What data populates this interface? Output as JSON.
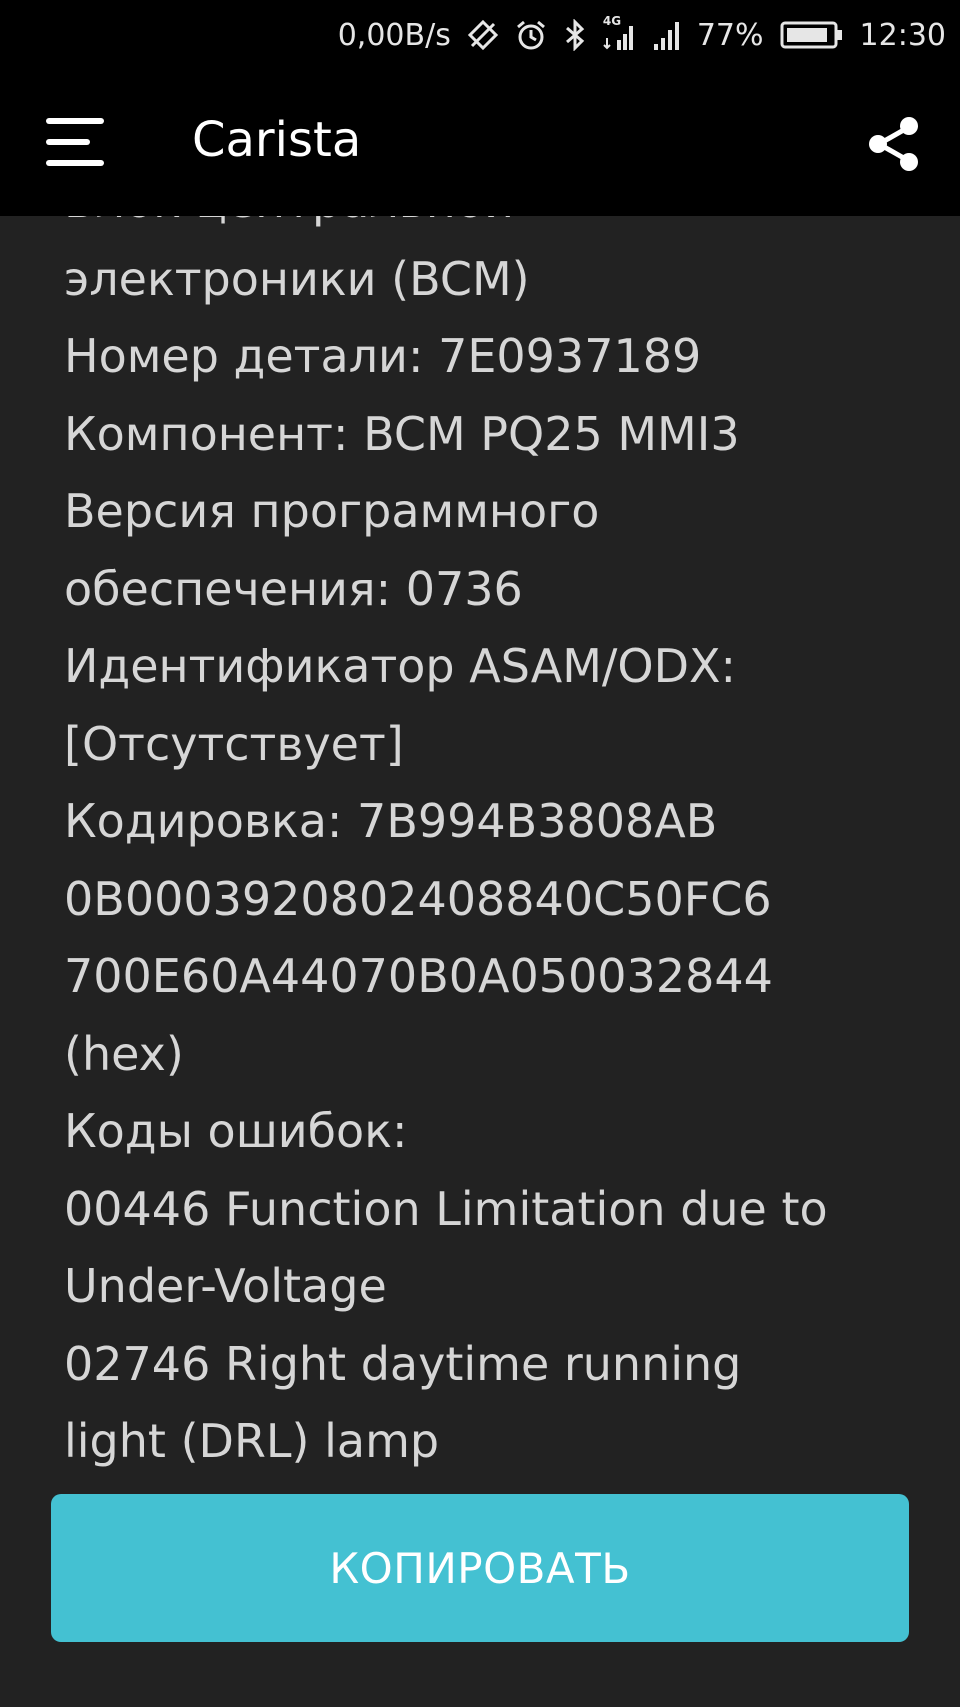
{
  "status_bar": {
    "net_speed": "0,00B/s",
    "network_type": "4G",
    "battery": "77%",
    "time": "12:30",
    "icons": [
      "data-saver-icon",
      "alarm-icon",
      "bluetooth-icon",
      "mobile-data-icon",
      "signal-icon",
      "battery-icon"
    ]
  },
  "app_bar": {
    "title": "Carista",
    "menu_icon": "hamburger-menu-icon",
    "share_icon": "share-icon"
  },
  "content": {
    "lines": [
      "Блок центральной",
      "электроники (BCM)",
      "Номер детали: 7E0937189",
      "Компонент: BCM PQ25 MMI3",
      "Версия программного",
      "обеспечения: 0736",
      "Идентификатор ASAM/ODX:",
      "[Отсутствует]",
      "Кодировка: 7B994B3808AB",
      "0B0003920802408840C50FC6",
      "700E60A44070B0A050032844",
      "(hex)",
      "Коды ошибок:",
      "00446 Function Limitation due to",
      "Under-Voltage",
      "02746 Right daytime running",
      "light (DRL) lamp"
    ]
  },
  "copy_button": {
    "label": "КОПИРОВАТЬ"
  },
  "colors": {
    "background": "#222222",
    "bars": "#000000",
    "text": "#d6d6d6",
    "accent": "#44c1d2"
  }
}
